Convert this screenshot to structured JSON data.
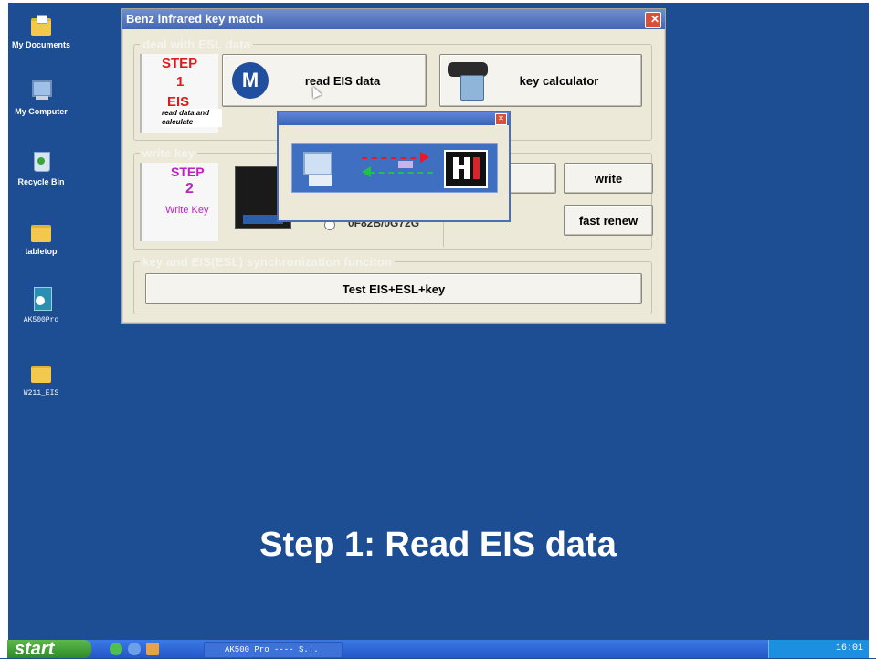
{
  "desktop": {
    "icons": [
      {
        "label": "My Documents"
      },
      {
        "label": "My Computer"
      },
      {
        "label": "Recycle Bin"
      },
      {
        "label": "tabletop"
      },
      {
        "label": "AK500Pro"
      },
      {
        "label": "W211_EIS"
      }
    ]
  },
  "window": {
    "title": "Benz infrared key match",
    "close_label": "✕",
    "group1": {
      "legend": "deal with ESL data",
      "step_word": "STEP",
      "step_number": "1",
      "step_name": "EIS",
      "step_desc": "read data and calculate",
      "read_button": "read EIS data",
      "calc_button": "key calculator"
    },
    "group2": {
      "legend": "write key",
      "step_word": "STEP",
      "step_number": "2",
      "step_name": "Write Key",
      "part_number": "0F82B/0G72G",
      "write_button": "write",
      "renew_button": "fast renew"
    },
    "group3": {
      "legend": "key and EIS(ESL) synchronization funciton",
      "test_button": "Test EIS+ESL+key"
    }
  },
  "popup": {
    "close_label": "✕"
  },
  "caption": "Step 1: Read EIS data",
  "taskbar": {
    "start_label": "start",
    "task_label": "AK500 Pro ---- S...",
    "clock": "16:01"
  },
  "colors": {
    "desktop": "#1d4d93",
    "step1": "#e0191f",
    "step2": "#c21fc9",
    "titlebar": "#4466b3"
  }
}
